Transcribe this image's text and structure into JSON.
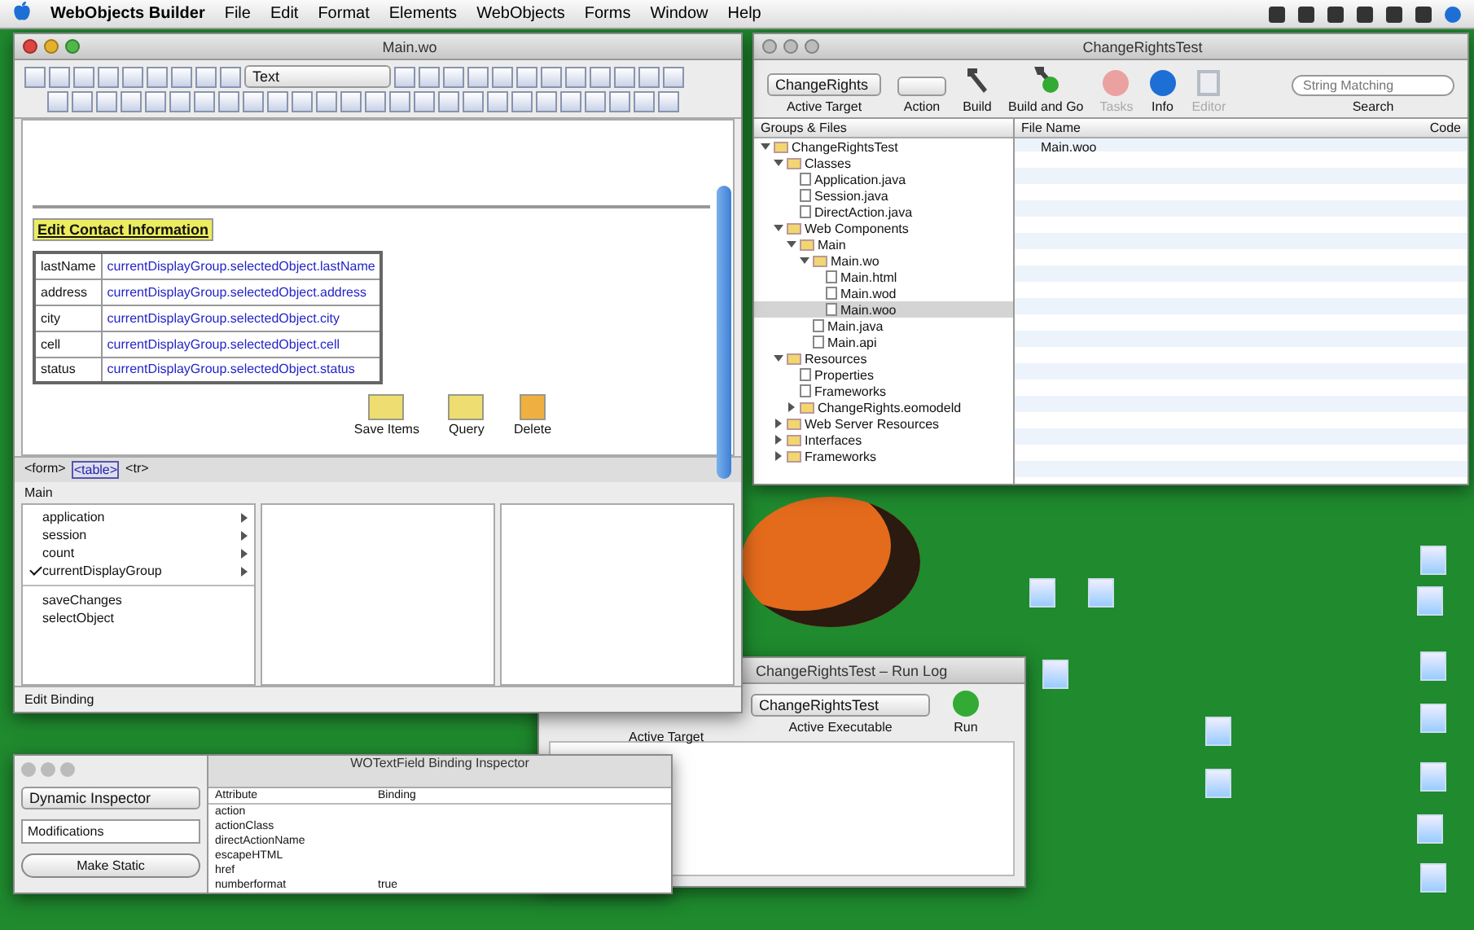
{
  "menubar": {
    "app": "WebObjects Builder",
    "menus": [
      "File",
      "Edit",
      "Format",
      "Elements",
      "WebObjects",
      "Forms",
      "Window",
      "Help"
    ]
  },
  "component_window": {
    "title": "Main.wo",
    "font_popup": "Text",
    "heading": "Edit Contact Information",
    "form_rows": [
      {
        "label": "lastName",
        "binding": "currentDisplayGroup.selectedObject.lastName"
      },
      {
        "label": "address",
        "binding": "currentDisplayGroup.selectedObject.address"
      },
      {
        "label": "city",
        "binding": "currentDisplayGroup.selectedObject.city"
      },
      {
        "label": "cell",
        "binding": "currentDisplayGroup.selectedObject.cell"
      },
      {
        "label": "status",
        "binding": "currentDisplayGroup.selectedObject.status"
      }
    ],
    "image_buttons": [
      "Save Items",
      "Query",
      "Delete"
    ],
    "path": [
      "<form>",
      "<table>",
      "<tr>"
    ],
    "browser": {
      "title": "Main",
      "keys": [
        {
          "label": "application",
          "has_children": true,
          "checked": false
        },
        {
          "label": "session",
          "has_children": true,
          "checked": false
        },
        {
          "label": "count",
          "has_children": true,
          "checked": false
        },
        {
          "label": "currentDisplayGroup",
          "has_children": true,
          "checked": true
        }
      ],
      "actions": [
        "saveChanges",
        "selectObject"
      ]
    },
    "status": "Edit Binding"
  },
  "project_window": {
    "title": "ChangeRightsTest",
    "target_popup": "ChangeRights",
    "search_placeholder": "String Matching",
    "toolbar": [
      {
        "kind": "popup",
        "label": "Active Target",
        "disabled": false
      },
      {
        "kind": "action",
        "label": "Action",
        "disabled": false
      },
      {
        "kind": "build",
        "label": "Build",
        "disabled": false
      },
      {
        "kind": "buildgo",
        "label": "Build and Go",
        "disabled": false
      },
      {
        "kind": "stop",
        "label": "Tasks",
        "disabled": true
      },
      {
        "kind": "info",
        "label": "Info",
        "disabled": false
      },
      {
        "kind": "editor",
        "label": "Editor",
        "disabled": true
      },
      {
        "kind": "search",
        "label": "Search",
        "disabled": false
      }
    ],
    "tree_header": "Groups & Files",
    "tree": [
      {
        "label": "ChangeRightsTest",
        "kind": "project",
        "expanded": true,
        "selected": false,
        "children": [
          {
            "label": "Classes",
            "kind": "folder",
            "expanded": true,
            "selected": false,
            "children": [
              {
                "label": "Application.java",
                "kind": "file",
                "selected": false
              },
              {
                "label": "Session.java",
                "kind": "file",
                "selected": false
              },
              {
                "label": "DirectAction.java",
                "kind": "file",
                "selected": false
              }
            ]
          },
          {
            "label": "Web Components",
            "kind": "folder",
            "expanded": true,
            "selected": false,
            "children": [
              {
                "label": "Main",
                "kind": "folder",
                "expanded": true,
                "selected": false,
                "children": [
                  {
                    "label": "Main.wo",
                    "kind": "component",
                    "expanded": true,
                    "selected": false,
                    "children": [
                      {
                        "label": "Main.html",
                        "kind": "file",
                        "selected": false
                      },
                      {
                        "label": "Main.wod",
                        "kind": "file",
                        "selected": false
                      },
                      {
                        "label": "Main.woo",
                        "kind": "file",
                        "selected": true
                      }
                    ]
                  },
                  {
                    "label": "Main.java",
                    "kind": "file",
                    "selected": false
                  },
                  {
                    "label": "Main.api",
                    "kind": "file",
                    "selected": false
                  }
                ]
              }
            ]
          },
          {
            "label": "Resources",
            "kind": "folder",
            "expanded": true,
            "selected": false,
            "children": [
              {
                "label": "Properties",
                "kind": "file",
                "selected": false
              },
              {
                "label": "Frameworks",
                "kind": "file",
                "selected": false
              },
              {
                "label": "ChangeRights.eomodeld",
                "kind": "folder",
                "expanded": false,
                "selected": false
              }
            ]
          },
          {
            "label": "Web Server Resources",
            "kind": "folder",
            "expanded": false,
            "selected": false
          },
          {
            "label": "Interfaces",
            "kind": "folder",
            "expanded": false,
            "selected": false
          },
          {
            "label": "Frameworks",
            "kind": "folder",
            "expanded": false,
            "selected": false
          }
        ]
      }
    ],
    "columns": [
      "File Name",
      "Code"
    ],
    "files": [
      "Main.woo"
    ]
  },
  "run_window": {
    "title": "ChangeRightsTest – Run Log",
    "target_popup": "ChangeRightsTest",
    "labels": [
      "Active Target",
      "Active Executable",
      "Run"
    ]
  },
  "inspector": {
    "title": "WOTextField Binding Inspector",
    "popup": "Dynamic Inspector",
    "field": "Modifications",
    "button": "Make Static",
    "columns": [
      "Attribute",
      "Binding"
    ],
    "rows": [
      {
        "attribute": "action"
      },
      {
        "attribute": "actionClass"
      },
      {
        "attribute": "directActionName"
      },
      {
        "attribute": "escapeHTML"
      },
      {
        "attribute": "href"
      },
      {
        "attribute": "numberformat",
        "binding": "true"
      }
    ]
  }
}
